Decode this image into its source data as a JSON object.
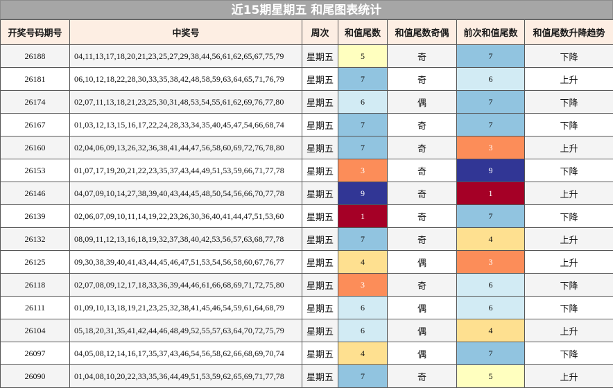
{
  "title": "近15期星期五 和尾图表统计",
  "headers": [
    "开奖号码期号",
    "中奖号",
    "周次",
    "和值尾数",
    "和值尾数奇偶",
    "前次和值尾数",
    "和值尾数升降趋势"
  ],
  "colors": {
    "1": "#a50026",
    "3": "#fc8d59",
    "4": "#fee090",
    "5": "#ffffbf",
    "6": "#d2ebf4",
    "7": "#91c4e0",
    "9": "#313695"
  },
  "rows": [
    {
      "issue": "26188",
      "numbers": "04,11,13,17,18,20,21,23,25,27,29,38,44,56,61,62,65,67,75,79",
      "week": "星期五",
      "tail": "5",
      "parity": "奇",
      "prev": "7",
      "trend": "下降"
    },
    {
      "issue": "26181",
      "numbers": "06,10,12,18,22,28,30,33,35,38,42,48,58,59,63,64,65,71,76,79",
      "week": "星期五",
      "tail": "7",
      "parity": "奇",
      "prev": "6",
      "trend": "上升"
    },
    {
      "issue": "26174",
      "numbers": "02,07,11,13,18,21,23,25,30,31,48,53,54,55,61,62,69,76,77,80",
      "week": "星期五",
      "tail": "6",
      "parity": "偶",
      "prev": "7",
      "trend": "下降"
    },
    {
      "issue": "26167",
      "numbers": "01,03,12,13,15,16,17,22,24,28,33,34,35,40,45,47,54,66,68,74",
      "week": "星期五",
      "tail": "7",
      "parity": "奇",
      "prev": "7",
      "trend": "下降"
    },
    {
      "issue": "26160",
      "numbers": "02,04,06,09,13,26,32,36,38,41,44,47,56,58,60,69,72,76,78,80",
      "week": "星期五",
      "tail": "7",
      "parity": "奇",
      "prev": "3",
      "trend": "上升"
    },
    {
      "issue": "26153",
      "numbers": "01,07,17,19,20,21,22,23,35,37,43,44,49,51,53,59,66,71,77,78",
      "week": "星期五",
      "tail": "3",
      "parity": "奇",
      "prev": "9",
      "trend": "下降"
    },
    {
      "issue": "26146",
      "numbers": "04,07,09,10,14,27,38,39,40,43,44,45,48,50,54,56,66,70,77,78",
      "week": "星期五",
      "tail": "9",
      "parity": "奇",
      "prev": "1",
      "trend": "上升"
    },
    {
      "issue": "26139",
      "numbers": "02,06,07,09,10,11,14,19,22,23,26,30,36,40,41,44,47,51,53,60",
      "week": "星期五",
      "tail": "1",
      "parity": "奇",
      "prev": "7",
      "trend": "下降"
    },
    {
      "issue": "26132",
      "numbers": "08,09,11,12,13,16,18,19,32,37,38,40,42,53,56,57,63,68,77,78",
      "week": "星期五",
      "tail": "7",
      "parity": "奇",
      "prev": "4",
      "trend": "上升"
    },
    {
      "issue": "26125",
      "numbers": "09,30,38,39,40,41,43,44,45,46,47,51,53,54,56,58,60,67,76,77",
      "week": "星期五",
      "tail": "4",
      "parity": "偶",
      "prev": "3",
      "trend": "上升"
    },
    {
      "issue": "26118",
      "numbers": "02,07,08,09,12,17,18,33,36,39,44,46,61,66,68,69,71,72,75,80",
      "week": "星期五",
      "tail": "3",
      "parity": "奇",
      "prev": "6",
      "trend": "下降"
    },
    {
      "issue": "26111",
      "numbers": "01,09,10,13,18,19,21,23,25,32,38,41,45,46,54,59,61,64,68,79",
      "week": "星期五",
      "tail": "6",
      "parity": "偶",
      "prev": "6",
      "trend": "下降"
    },
    {
      "issue": "26104",
      "numbers": "05,18,20,31,35,41,42,44,46,48,49,52,55,57,63,64,70,72,75,79",
      "week": "星期五",
      "tail": "6",
      "parity": "偶",
      "prev": "4",
      "trend": "上升"
    },
    {
      "issue": "26097",
      "numbers": "04,05,08,12,14,16,17,35,37,43,46,54,56,58,62,66,68,69,70,74",
      "week": "星期五",
      "tail": "4",
      "parity": "偶",
      "prev": "7",
      "trend": "下降"
    },
    {
      "issue": "26090",
      "numbers": "01,04,08,10,20,22,33,35,36,44,49,51,53,59,62,65,69,71,77,78",
      "week": "星期五",
      "tail": "7",
      "parity": "奇",
      "prev": "5",
      "trend": "上升"
    }
  ]
}
